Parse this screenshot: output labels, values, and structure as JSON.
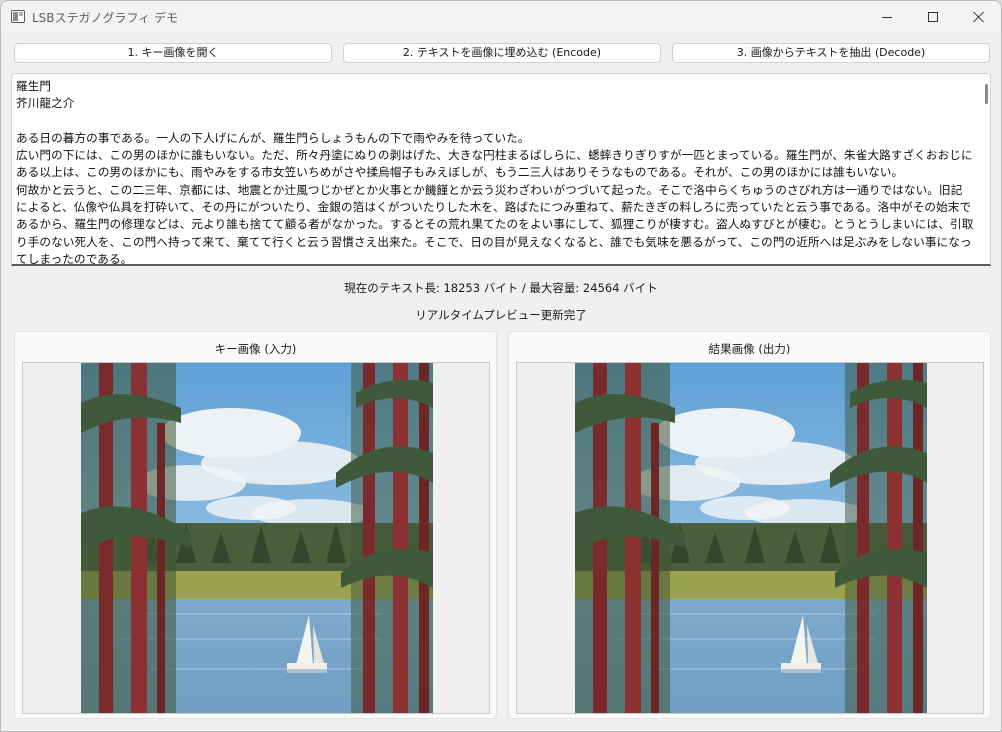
{
  "window": {
    "title": "LSBステガノグラフィ デモ"
  },
  "toolbar": {
    "open_label": "1. キー画像を開く",
    "encode_label": "2. テキストを画像に埋め込む (Encode)",
    "decode_label": "3. 画像からテキストを抽出 (Decode)"
  },
  "editor": {
    "text": "羅生門\n芥川龍之介\n\nある日の暮方の事である。一人の下人げにんが、羅生門らしょうもんの下で雨やみを待っていた。\n広い門の下には、この男のほかに誰もいない。ただ、所々丹塗にぬりの剥はげた、大きな円柱まるばしらに、蟋蟀きりぎりすが一匹とまっている。羅生門が、朱雀大路すざくおおじにある以上は、この男のほかにも、雨やみをする市女笠いちめがさや揉烏帽子もみえぼしが、もう二三人はありそうなものである。それが、この男のほかには誰もいない。\n何故かと云うと、この二三年、京都には、地震とか辻風つじかぜとか火事とか饑饉とか云う災わざわいがつづいて起った。そこで洛中らくちゅうのさびれ方は一通りではない。旧記によると、仏像や仏具を打砕いて、その丹にがついたり、金銀の箔はくがついたりした木を、路ばたにつみ重ねて、薪たきぎの料しろに売っていたと云う事である。洛中がその始末であるから、羅生門の修理などは、元より誰も捨てて顧る者がなかった。するとその荒れ果てたのをよい事にして、狐狸こりが棲すむ。盗人ぬすびとが棲む。とうとうしまいには、引取り手のない死人を、この門へ持って来て、棄てて行くと云う習慣さえ出来た。そこで、日の目が見えなくなると、誰でも気味を悪るがって、この門の近所へは足ぶみをしない事になってしまったのである。"
  },
  "status": {
    "length_text": "現在のテキスト長: 18253 バイト / 最大容量: 24564 バイト",
    "preview_text": "リアルタイムプレビュー更新完了"
  },
  "panels": {
    "input_title": "キー画像 (入力)",
    "output_title": "結果画像 (出力)"
  },
  "icons": {
    "app": "window-app-icon",
    "minimize": "minimize-icon",
    "maximize": "maximize-icon",
    "close": "close-icon"
  },
  "colors": {
    "sky": "#7fb6e0",
    "water": "#6f9fc4",
    "trunk": "#7a2a2a",
    "foliage": "#3f5a3a",
    "grass": "#9aa24e"
  }
}
